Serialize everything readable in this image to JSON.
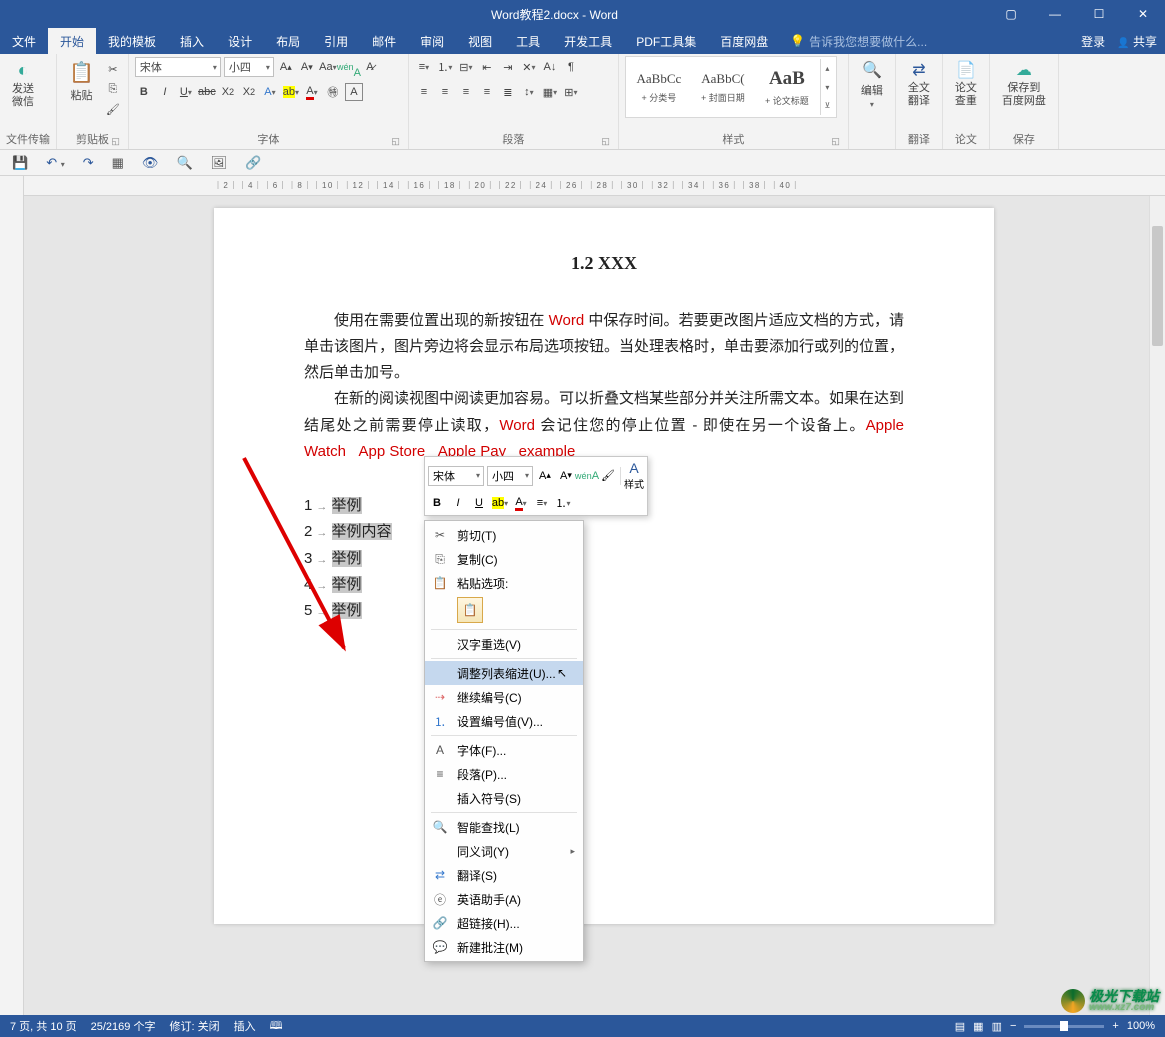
{
  "title": "Word教程2.docx - Word",
  "window_buttons": {
    "ribbon_opts": "▢",
    "min": "—",
    "max": "☐",
    "close": "✕"
  },
  "tabs": [
    "文件",
    "开始",
    "我的模板",
    "插入",
    "设计",
    "布局",
    "引用",
    "邮件",
    "审阅",
    "视图",
    "工具",
    "开发工具",
    "PDF工具集",
    "百度网盘"
  ],
  "active_tab_index": 1,
  "tell_me": "告诉我您想要做什么...",
  "account": {
    "login": "登录",
    "share": "共享"
  },
  "ribbon": {
    "send_wechat": "发送\n微信",
    "group_send": "文件传输",
    "paste": "粘贴",
    "group_clipboard": "剪贴板",
    "font_name": "宋体",
    "font_size": "小四",
    "group_font": "字体",
    "group_paragraph": "段落",
    "styles": [
      {
        "preview": "AaBbCc",
        "name": "+ 分类号"
      },
      {
        "preview": "AaBbC(",
        "name": "+ 封面日期"
      },
      {
        "preview": "AaB",
        "name": "+ 论文标题"
      }
    ],
    "group_styles": "样式",
    "edit": "编辑",
    "translate_full": "全文\n翻译",
    "group_translate": "翻译",
    "thesis_check": "论文\n查重",
    "group_thesis": "论文",
    "save_cloud": "保存到\n百度网盘",
    "group_save": "保存"
  },
  "ruler_text": "｜2｜｜4｜｜6｜｜8｜｜10｜｜12｜｜14｜｜16｜｜18｜｜20｜｜22｜｜24｜｜26｜｜28｜｜30｜｜32｜｜34｜｜36｜｜38｜｜40｜",
  "doc": {
    "heading": "1.2 XXX",
    "p1a": "使用在需要位置出现的新按钮在 ",
    "p1b": "Word",
    "p1c": " 中保存时间。若要更改图片适应文档的方式，请单击该图片，图片旁边将会显示布局选项按钮。当处理表格时，单击要添加行或列的位置，然后单击加号。",
    "p2a": "在新的阅读视图中阅读更加容易。可以折叠文档某些部分并关注所需文本。如果在达到结尾处之前需要停止读取，",
    "p2b": "Word",
    "p2c": " 会记住您的停止位置 - 即使在另一个设备上。",
    "proper1": "Apple Watch",
    "proper2": "App Store",
    "proper3": "Apple Pay",
    "proper4": "example",
    "list": [
      {
        "n": "1",
        "t": "举例"
      },
      {
        "n": "2",
        "t": "举例内容"
      },
      {
        "n": "3",
        "t": "举例"
      },
      {
        "n": "4",
        "t": "举例"
      },
      {
        "n": "5",
        "t": "举例"
      }
    ]
  },
  "mini": {
    "font": "宋体",
    "size": "小四",
    "styles_label": "样式"
  },
  "context_menu": {
    "cut": "剪切(T)",
    "copy": "复制(C)",
    "paste_label": "粘贴选项:",
    "hanzi": "汉字重选(V)",
    "adjust_indent": "调整列表缩进(U)...",
    "continue_num": "继续编号(C)",
    "set_num": "设置编号值(V)...",
    "font": "字体(F)...",
    "paragraph": "段落(P)...",
    "insert_symbol": "插入符号(S)",
    "smart_lookup": "智能查找(L)",
    "synonyms": "同义词(Y)",
    "translate": "翻译(S)",
    "english_helper": "英语助手(A)",
    "hyperlink": "超链接(H)...",
    "new_comment": "新建批注(M)"
  },
  "status": {
    "page": "7 页, 共 10 页",
    "words": "25/2169 个字",
    "track": "修订: 关闭",
    "insert": "插入",
    "zoom": "100%"
  },
  "watermark": {
    "text": "极光下载站",
    "url": "www.xz7.com"
  }
}
